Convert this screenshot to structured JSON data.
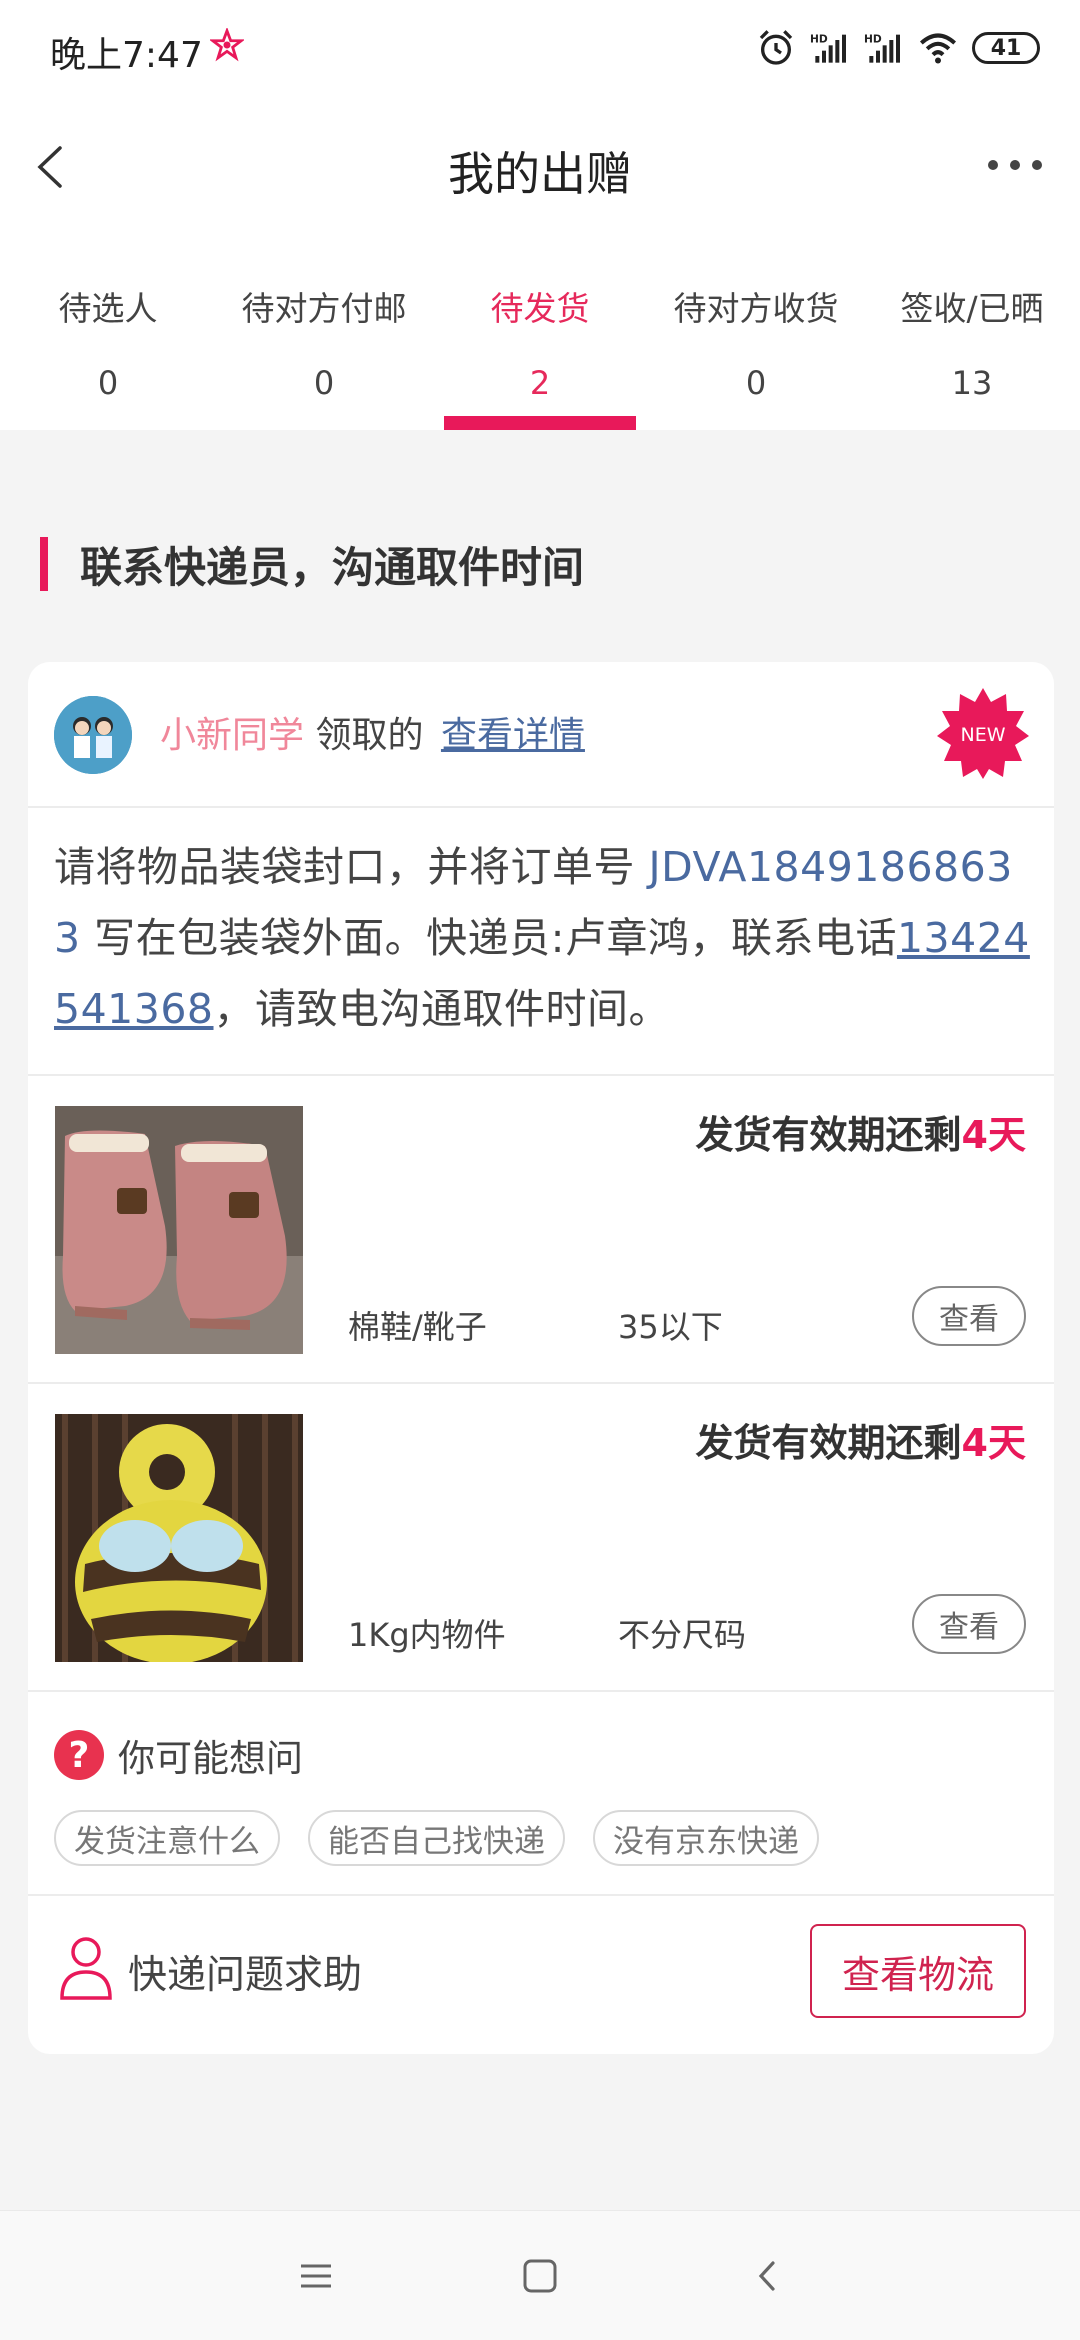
{
  "status_bar": {
    "time": "晚上7:47",
    "battery": "41",
    "hd_label": "HD"
  },
  "header": {
    "title": "我的出赠",
    "back_icon": "chevron-left-icon",
    "more_icon": "more-dots-icon"
  },
  "tabs": [
    {
      "label": "待选人",
      "count": "0",
      "active": false
    },
    {
      "label": "待对方付邮",
      "count": "0",
      "active": false
    },
    {
      "label": "待发货",
      "count": "2",
      "active": true
    },
    {
      "label": "待对方收货",
      "count": "0",
      "active": false
    },
    {
      "label": "签收/已晒",
      "count": "13",
      "active": false
    }
  ],
  "section": {
    "title": "联系快递员，沟通取件时间"
  },
  "card": {
    "claimer": "小新同学",
    "claim_suffix": "领取的",
    "detail_link": "查看详情",
    "new_badge": "NEW",
    "instruction": {
      "part1": "请将物品装袋封口，并将订单号 ",
      "order_no": "JDVA18491868633",
      "part2": " 写在包装袋外面。快递员:卢章鸿，联系电话",
      "phone": "13424541368",
      "part3": "，请致电沟通取件时间。"
    },
    "items": [
      {
        "deadline_prefix": "发货有效期还剩",
        "deadline_days": "4天",
        "category": "棉鞋/靴子",
        "size": "35以下",
        "view_label": "查看"
      },
      {
        "deadline_prefix": "发货有效期还剩",
        "deadline_days": "4天",
        "category": "1Kg内物件",
        "size": "不分尺码",
        "view_label": "查看"
      }
    ],
    "faq": {
      "title": "你可能想问",
      "icon_glyph": "?",
      "chips": [
        "发货注意什么",
        "能否自己找快递",
        "没有京东快递"
      ]
    },
    "help": {
      "label": "快递问题求助",
      "button": "查看物流"
    }
  },
  "colors": {
    "accent": "#e8195a",
    "link": "#4a6aa0",
    "claimer": "#f0879a"
  }
}
